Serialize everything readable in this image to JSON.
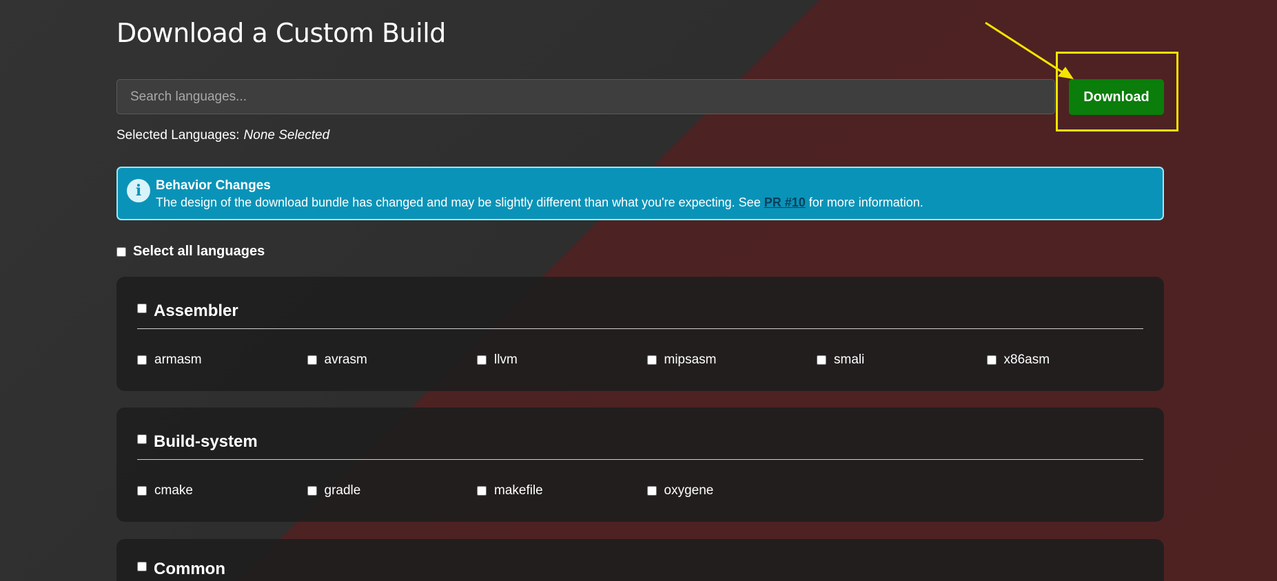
{
  "page": {
    "title": "Download a Custom Build"
  },
  "search": {
    "placeholder": "Search languages..."
  },
  "download_button": {
    "label": "Download",
    "color": "#0a7d0a"
  },
  "annotation": {
    "highlight_color": "#f5e400"
  },
  "selected": {
    "label": "Selected Languages:",
    "value": "None Selected"
  },
  "alert": {
    "icon": "info-icon",
    "heading": "Behavior Changes",
    "text_before": "The design of the download bundle has changed and may be slightly different than what you're expecting. See ",
    "link": "PR #10",
    "text_after": " for more information.",
    "color": "#0a93b8"
  },
  "select_all": {
    "label": "Select all languages"
  },
  "categories": [
    {
      "name": "Assembler",
      "languages": [
        "armasm",
        "avrasm",
        "llvm",
        "mipsasm",
        "smali",
        "x86asm"
      ]
    },
    {
      "name": "Build-system",
      "languages": [
        "cmake",
        "gradle",
        "makefile",
        "oxygene"
      ]
    },
    {
      "name": "Common",
      "languages": []
    }
  ]
}
